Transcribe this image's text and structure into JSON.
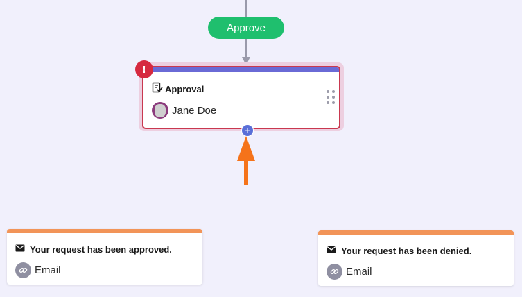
{
  "approve_branch": {
    "label": "Approve"
  },
  "approval_step": {
    "title": "Approval",
    "assignee": "Jane Doe",
    "error_indicator": "!",
    "add_button": "+"
  },
  "notifications": [
    {
      "title": "Your request has been approved.",
      "channel": "Email"
    },
    {
      "title": "Your request has been denied.",
      "channel": "Email"
    }
  ],
  "icons": {
    "approval": "document-check-icon",
    "mail": "envelope-icon",
    "channel": "link-icon",
    "drag": "drag-handle-icon"
  },
  "colors": {
    "canvas": "#f1f0fc",
    "approve_green": "#1fbf6e",
    "approval_accent": "#6a6ad6",
    "error_red": "#d6293f",
    "notification_accent": "#f29458",
    "callout_arrow": "#f5731a"
  }
}
